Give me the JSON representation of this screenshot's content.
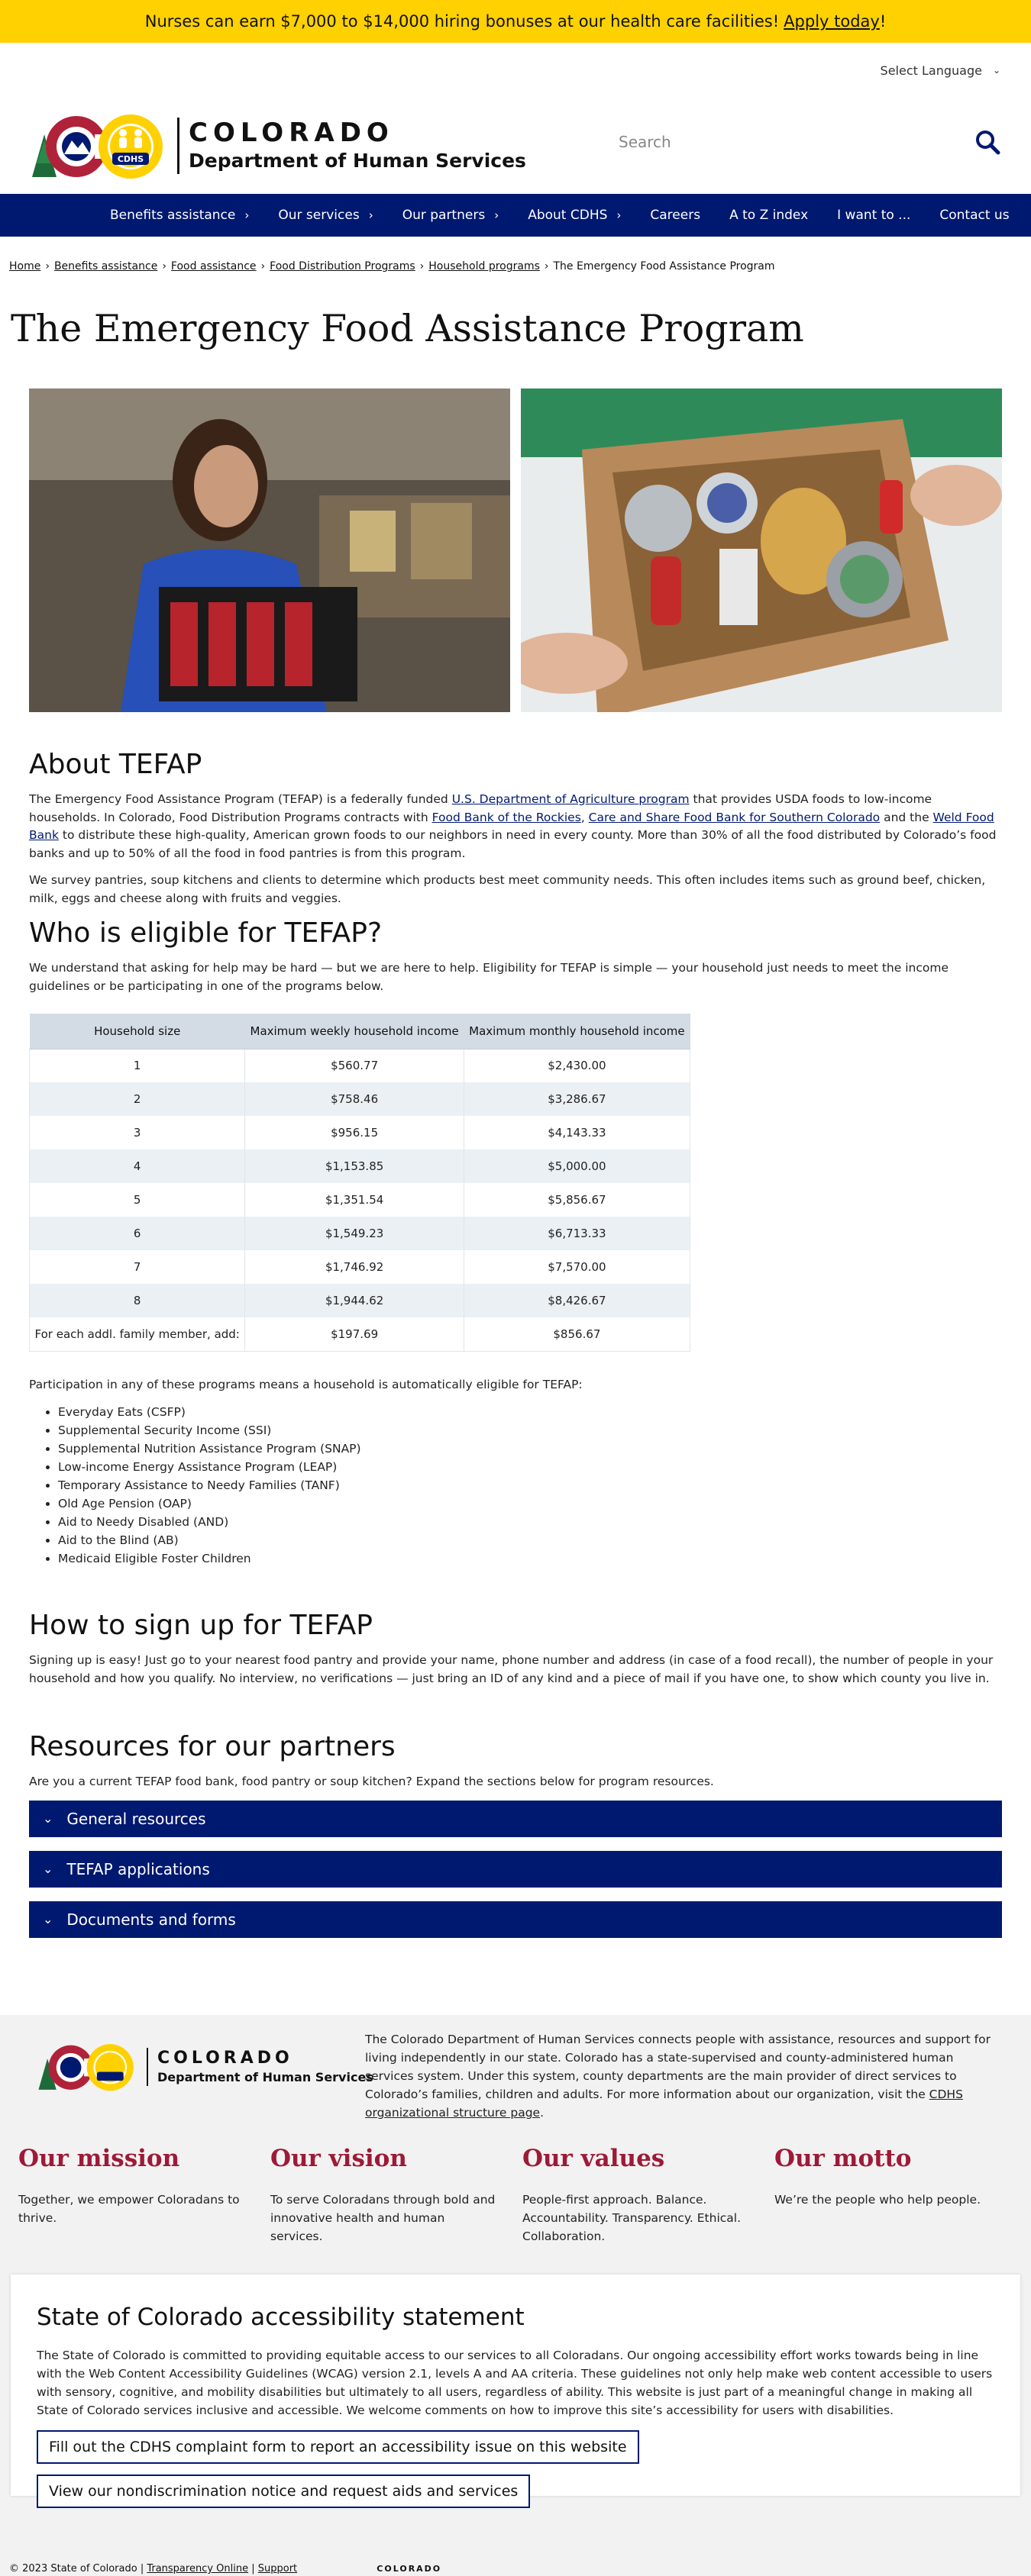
{
  "banner": {
    "text": "Nurses can earn $7,000 to $14,000 hiring bonuses at our health care facilities!",
    "link": "Apply today",
    "suffix": "!"
  },
  "language": {
    "label": "Select Language"
  },
  "header": {
    "logo_word": "COLORADO",
    "logo_dept": "Department of Human Services",
    "logo_cdhs": "CDHS"
  },
  "search": {
    "placeholder": "Search"
  },
  "nav": {
    "items": [
      "Benefits assistance",
      "Our services",
      "Our partners",
      "About CDHS",
      "Careers",
      "A to Z index",
      "I want to ...",
      "Contact us"
    ]
  },
  "breadcrumb": {
    "items": [
      "Home",
      "Benefits assistance",
      "Food assistance",
      "Food Distribution Programs",
      "Household programs"
    ],
    "current": "The Emergency Food Assistance Program"
  },
  "page": {
    "title": "The Emergency Food Assistance Program"
  },
  "about": {
    "heading": "About TEFAP",
    "p1a": "The Emergency Food Assistance Program (TEFAP) is a federally funded ",
    "p1_link1": "U.S. Department of Agriculture program",
    "p1b": " that provides USDA foods to low-income households. In Colorado, Food Distribution Programs contracts with ",
    "p1_link2": "Food Bank of the Rockies",
    "p1c": ", ",
    "p1_link3": "Care and Share Food Bank for Southern Colorado",
    "p1d": " and the ",
    "p1_link4": "Weld Food Bank",
    "p1e": " to distribute these high-quality, American grown foods to our neighbors in need in every county. More than 30% of all the food distributed by Colorado’s food banks and up to 50% of all the food in food pantries is from this program.",
    "p2": "We survey pantries, soup kitchens and clients to determine which products best meet community needs. This often includes items such as ground beef, chicken, milk, eggs and cheese along with fruits and veggies."
  },
  "eligible": {
    "heading": "Who is eligible for TEFAP?",
    "p1": "We understand that asking for help may be hard — but we are here to help. Eligibility for TEFAP is simple — your household just needs to meet the income guidelines or be participating in one of the programs below.",
    "table": {
      "headers": [
        "Household size",
        "Maximum weekly household income",
        "Maximum monthly household income"
      ],
      "rows": [
        [
          "1",
          "$560.77",
          "$2,430.00"
        ],
        [
          "2",
          "$758.46",
          "$3,286.67"
        ],
        [
          "3",
          "$956.15",
          "$4,143.33"
        ],
        [
          "4",
          "$1,153.85",
          "$5,000.00"
        ],
        [
          "5",
          "$1,351.54",
          "$5,856.67"
        ],
        [
          "6",
          "$1,549.23",
          "$6,713.33"
        ],
        [
          "7",
          "$1,746.92",
          "$7,570.00"
        ],
        [
          "8",
          "$1,944.62",
          "$8,426.67"
        ],
        [
          "For each addl. family member, add:",
          "$197.69",
          "$856.67"
        ]
      ]
    },
    "p2": "Participation in any of these programs means a household is automatically eligible for TEFAP:",
    "programs": [
      "Everyday Eats (CSFP)",
      "Supplemental Security Income (SSI)",
      "Supplemental Nutrition Assistance Program (SNAP)",
      "Low-income Energy Assistance Program (LEAP)",
      "Temporary Assistance to Needy Families (TANF)",
      "Old Age Pension (OAP)",
      "Aid to Needy Disabled (AND)",
      "Aid to the Blind (AB)",
      "Medicaid Eligible Foster Children"
    ]
  },
  "signup": {
    "heading": "How to sign up for TEFAP",
    "p1": "Signing up is easy! Just go to your nearest food pantry and provide your name, phone number and address (in case of a food recall), the number of people in your household and how you qualify. No interview, no verifications — just bring an ID of any kind and a piece of mail if you have one, to show which county you live in."
  },
  "resources": {
    "heading": "Resources for our partners",
    "p1": "Are you a current TEFAP food bank, food pantry or soup kitchen? Expand the sections below for program resources.",
    "sections": [
      "General resources",
      "TEFAP applications",
      "Documents and forms"
    ]
  },
  "footer": {
    "desc": "The Colorado Department of Human Services connects people with assistance, resources and support for living independently in our state. Colorado has a state-supervised and county-administered human services system. Under this system, county departments are the main provider of direct services to Colorado’s families, children and adults. For more information about our organization, visit the ",
    "desc_link": "CDHS organizational structure page",
    "desc_end": ".",
    "mission": {
      "title": "Our mission",
      "text": "Together, we empower Coloradans to thrive."
    },
    "vision": {
      "title": "Our vision",
      "text": "To serve Coloradans through bold and innovative health and human services."
    },
    "values": {
      "title": "Our values",
      "text": "People-first approach. Balance. Accountability. Transparency. Ethical. Collaboration."
    },
    "motto": {
      "title": "Our motto",
      "text": "We’re the people who help people."
    }
  },
  "accessibility": {
    "heading": "State of Colorado accessibility statement",
    "p1": "The State of Colorado is committed to providing equitable access to our services to all Coloradans. Our ongoing accessibility effort works towards being in line with the Web Content Accessibility Guidelines (WCAG) version 2.1, levels A and AA criteria. These guidelines not only help make web content accessible to users with sensory, cognitive, and mobility disabilities but ultimately to all users, regardless of ability. This website is just part of a meaningful change in making all State of Colorado services inclusive and accessible. We welcome comments on how to improve this site’s accessibility for users with disabilities.",
    "button1": "Fill out the CDHS complaint form to report an accessibility issue on this website",
    "button2": "View our nondiscrimination notice and request aids and services"
  },
  "bottom": {
    "copyright": "© 2023 State of Colorado",
    "link1": "Transparency Online",
    "link2": "Support",
    "logo_word": "COLORADO"
  },
  "colors": {
    "banner": "#ffd100",
    "navy": "#001970",
    "maroon": "#9e1a37"
  }
}
